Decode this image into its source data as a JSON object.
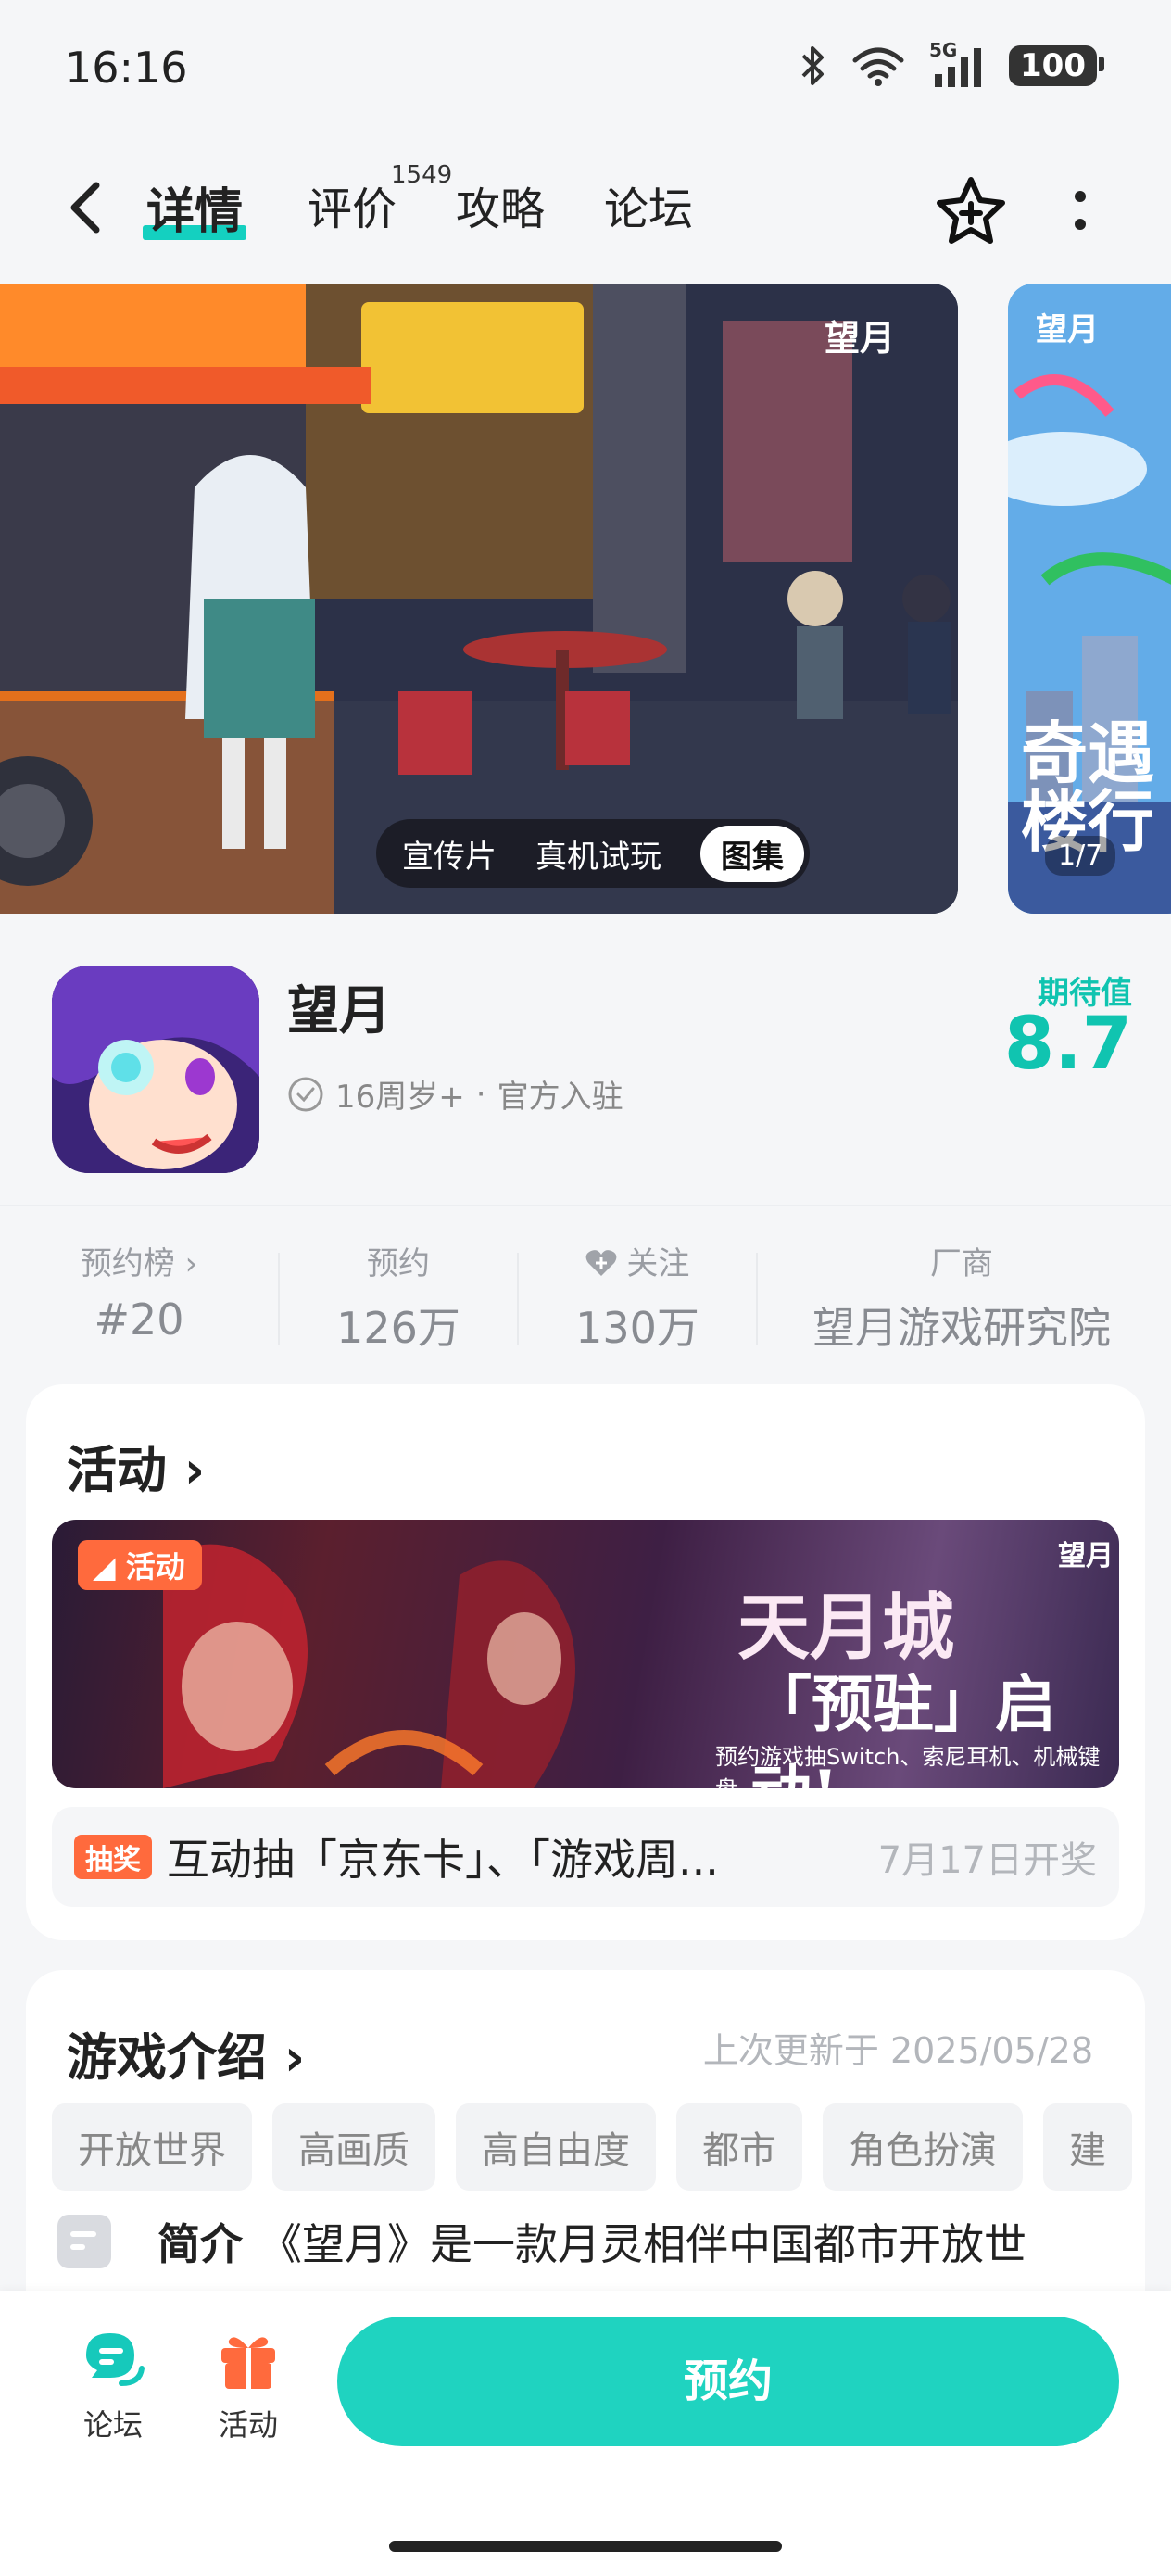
{
  "status_bar": {
    "time": "16:16",
    "network": "5G",
    "battery": "100"
  },
  "nav": {
    "tabs": [
      {
        "label": "详情",
        "active": true
      },
      {
        "label": "评价",
        "count": "1549"
      },
      {
        "label": "攻略"
      },
      {
        "label": "论坛"
      }
    ],
    "icons": [
      "back-icon",
      "star-add-icon",
      "more-vertical-icon"
    ]
  },
  "media": {
    "switch": [
      "宣传片",
      "真机试玩",
      "图集"
    ],
    "selected": "图集",
    "watermark": "望月",
    "second_page_indicator": "1/7",
    "second_overlay": "奇遇 楼行"
  },
  "game": {
    "title": "望月",
    "age_rating": "16周岁+",
    "badge": "官方入驻",
    "score_label": "期待值",
    "score": "8.7"
  },
  "stats": [
    {
      "label": "预约榜",
      "value": "#20"
    },
    {
      "label": "预约",
      "value": "126万"
    },
    {
      "label": "关注",
      "value": "130万"
    },
    {
      "label": "厂商",
      "value": "望月游戏研究院"
    }
  ],
  "activity": {
    "section_title": "活动",
    "banner_badge": "活动",
    "banner_headline": "天月城",
    "banner_sub": "「预驻」启动!",
    "banner_desc": "预约游戏抽Switch、索尼耳机、机械键盘",
    "lottery_tag": "抽奖",
    "lottery_text": "互动抽「京东卡」、「游戏周...",
    "lottery_date": "7月17日开奖"
  },
  "intro": {
    "section_title": "游戏介绍",
    "updated": "上次更新于 2025/05/28",
    "tags": [
      "开放世界",
      "高画质",
      "高自由度",
      "都市",
      "角色扮演",
      "建"
    ],
    "summary_label": "简介",
    "summary_text": "《望月》是一款月灵相伴中国都市开放世"
  },
  "bottom_bar": {
    "forum_label": "论坛",
    "activity_label": "活动",
    "reserve_label": "预约"
  },
  "colors": {
    "accent": "#1fd3c0",
    "orange": "#ff6a3d"
  }
}
